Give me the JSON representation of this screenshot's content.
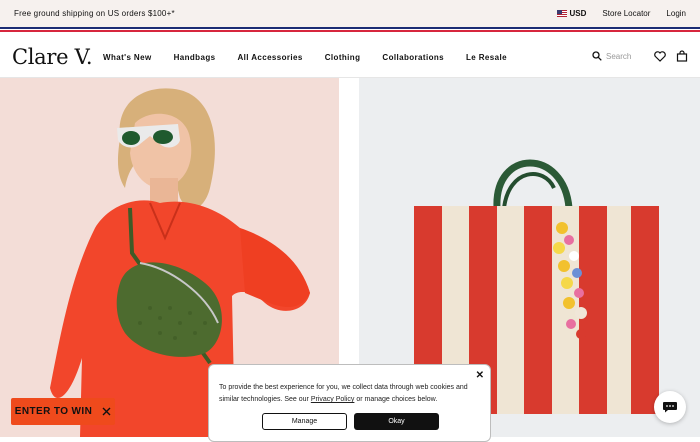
{
  "topbar": {
    "promo": "Free ground shipping on US orders $100+*",
    "currency": "USD",
    "store_locator": "Store Locator",
    "login": "Login"
  },
  "nav": {
    "logo": "Clare V.",
    "menu": [
      "What's New",
      "Handbags",
      "All Accessories",
      "Clothing",
      "Collaborations",
      "Le Resale"
    ],
    "search_placeholder": "Search"
  },
  "promo_button": {
    "label": "ENTER TO WIN"
  },
  "cookie_banner": {
    "text_before": "To provide the best experience for you, we collect data through web cookies and similar technologies. See our ",
    "link": "Privacy Policy",
    "text_after": " or manage choices below.",
    "manage_label": "Manage",
    "okay_label": "Okay"
  },
  "icons": {
    "search": "search-icon",
    "wishlist": "heart-icon",
    "bag": "shopping-bag-icon",
    "close": "close-icon",
    "chat": "chat-icon",
    "flag": "us-flag-icon"
  },
  "colors": {
    "accent_orange": "#ef4a1c",
    "stripe_blue": "#1b2c74",
    "stripe_red": "#d7263d",
    "left_panel_bg": "#f3ddd7",
    "right_panel_bg": "#eceef0"
  }
}
